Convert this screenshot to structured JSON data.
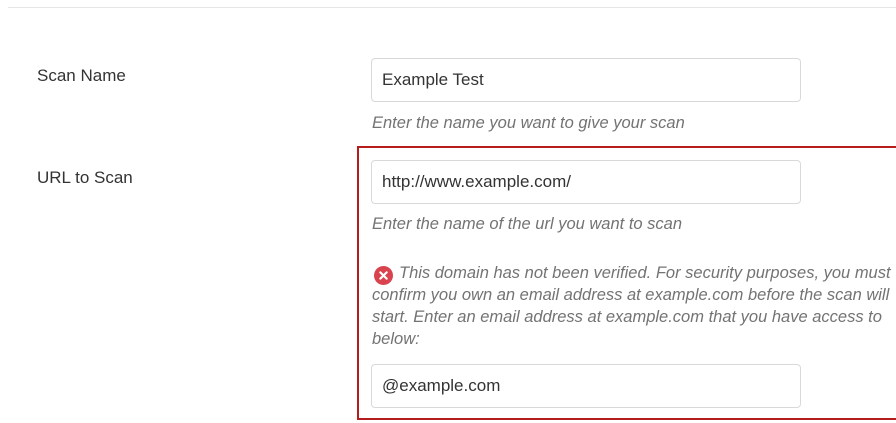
{
  "form": {
    "scan_name": {
      "label": "Scan Name",
      "value": "Example Test",
      "help": "Enter the name you want to give your scan"
    },
    "url_to_scan": {
      "label": "URL to Scan",
      "value": "http://www.example.com/",
      "help": "Enter the name of the url you want to scan",
      "error": {
        "icon": "error-x-circle-icon",
        "message": "This domain has not been verified. For security purposes, you must confirm you own an email address at example.com before the scan will start. Enter an email address at example.com that you have access to below:"
      },
      "email_value": "@example.com"
    }
  },
  "colors": {
    "error_border": "#b71c1c",
    "error_icon": "#d9434e",
    "help_text": "#737373"
  }
}
